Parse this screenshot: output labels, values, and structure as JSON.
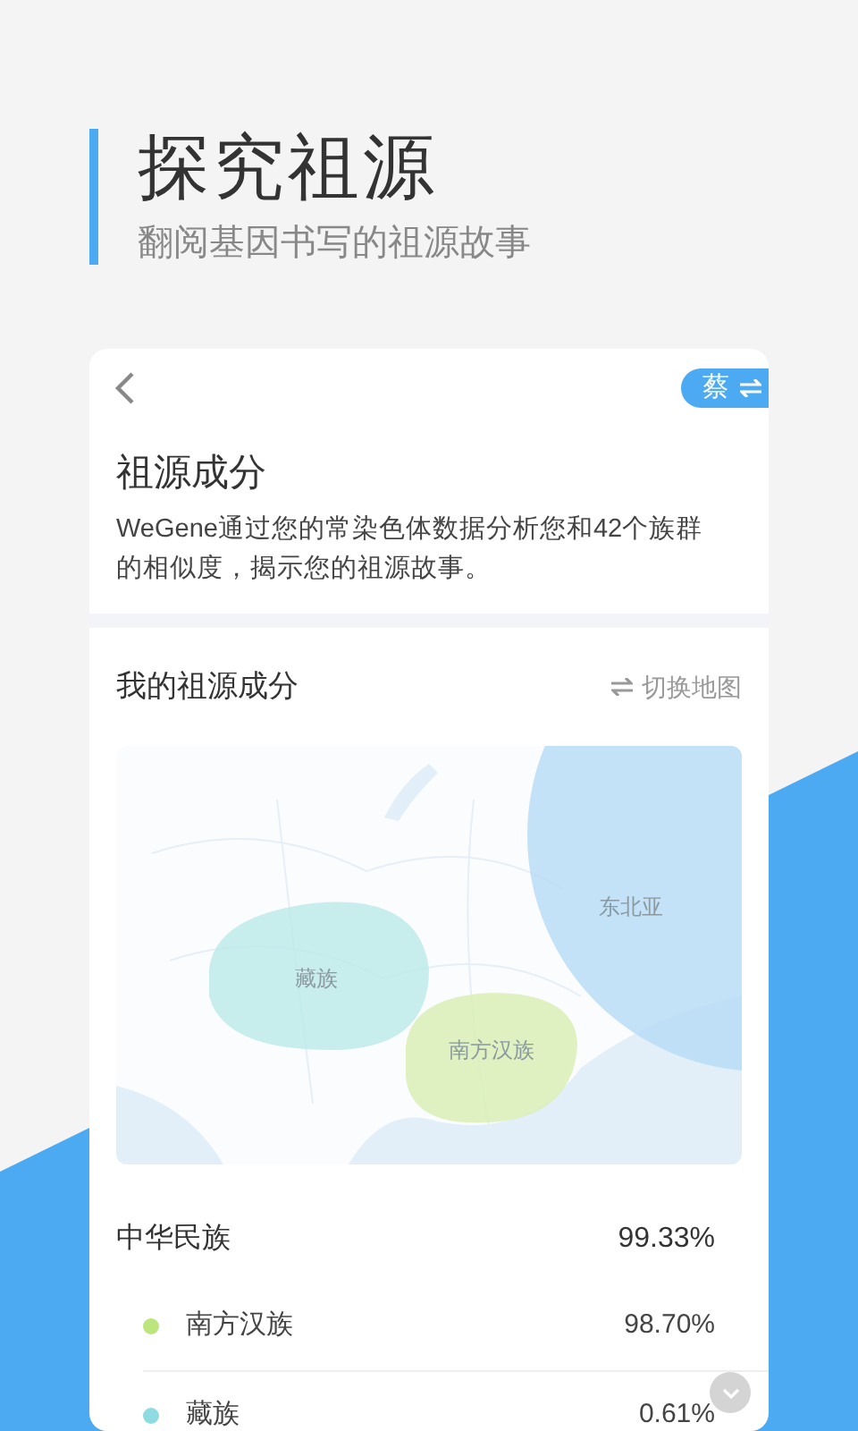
{
  "header": {
    "title": "探究祖源",
    "subtitle": "翻阅基因书写的祖源故事"
  },
  "card": {
    "surname": "蔡",
    "title": "祖源成分",
    "description": "WeGene通过您的常染色体数据分析您和42个族群的相似度，揭示您的祖源故事。"
  },
  "ancestry": {
    "title": "我的祖源成分",
    "switch_label": "切换地图",
    "map_regions": [
      {
        "name": "东北亚",
        "color": "#b9dcf6"
      },
      {
        "name": "藏族",
        "color": "#bdeaea"
      },
      {
        "name": "南方汉族",
        "color": "#d9efb6"
      }
    ],
    "groups": [
      {
        "name": "中华民族",
        "percent": "99.33%",
        "children": [
          {
            "name": "南方汉族",
            "percent": "98.70%",
            "color": "#bde57e"
          },
          {
            "name": "藏族",
            "percent": "0.61%",
            "color": "#8fdbe2"
          }
        ]
      }
    ]
  }
}
